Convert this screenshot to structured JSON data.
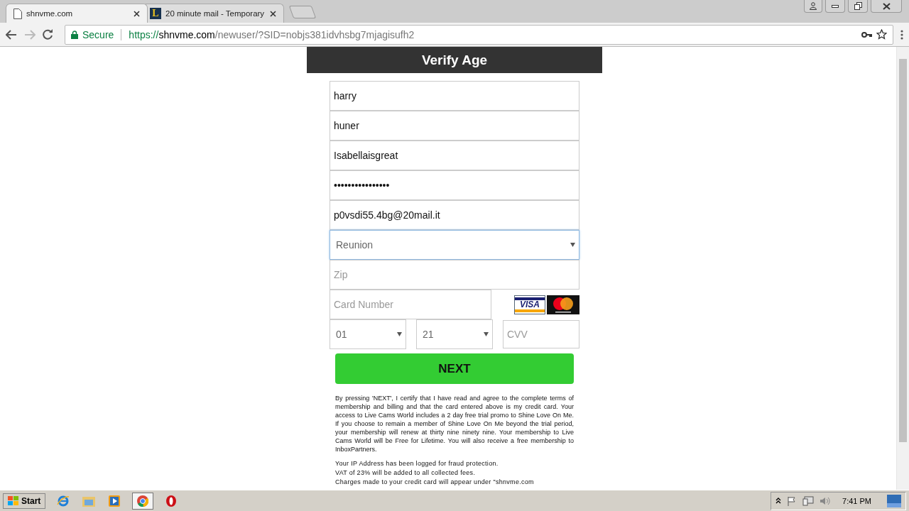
{
  "browser": {
    "tabs": [
      {
        "title": "shnvme.com",
        "selected": true
      },
      {
        "title": "20 minute mail - Temporary",
        "selected": false,
        "icon_letter": "L"
      }
    ],
    "security": "Secure",
    "url": {
      "scheme": "https://",
      "host": "shnvme.com",
      "path": "/newuser/?SID=nobjs381idvhsbg7mjagisufh2"
    }
  },
  "form": {
    "title": "Verify Age",
    "fields": [
      {
        "kind": "text",
        "value": "harry"
      },
      {
        "kind": "text",
        "value": "huner"
      },
      {
        "kind": "text",
        "value": "Isabellaisgreat"
      },
      {
        "kind": "text",
        "value": "••••••••••••••••"
      },
      {
        "kind": "text",
        "value": "p0vsdi55.4bg@20mail.it"
      },
      {
        "kind": "select",
        "value": "Reunion"
      },
      {
        "kind": "placeholder",
        "placeholder": "Zip"
      }
    ],
    "card_number": {
      "placeholder": "Card Number"
    },
    "card_logo_label": "VISA",
    "month": "01",
    "year": "21",
    "cvv": {
      "placeholder": "CVV"
    },
    "submit": "NEXT",
    "legal": "By pressing 'NEXT', I certify that I have read and agree to the complete terms of membership and billing and that the card entered above is my credit card. Your access to Live Cams World includes a 2 day free trial promo to Shine Love On Me. If you choose to remain a member of Shine Love On Me beyond the trial period, your membership will renew at thirty nine ninety nine. Your membership to Live Cams World will be Free for Lifetime. You will also receive a free membership to InboxPartners.",
    "notes": [
      "Your IP Address has been logged for fraud protection.",
      "VAT of 23% will be added to all collected fees.",
      "Charges made to your credit card will appear under \"shnvme.com"
    ]
  },
  "taskbar": {
    "start": "Start",
    "clock": "7:41 PM"
  }
}
